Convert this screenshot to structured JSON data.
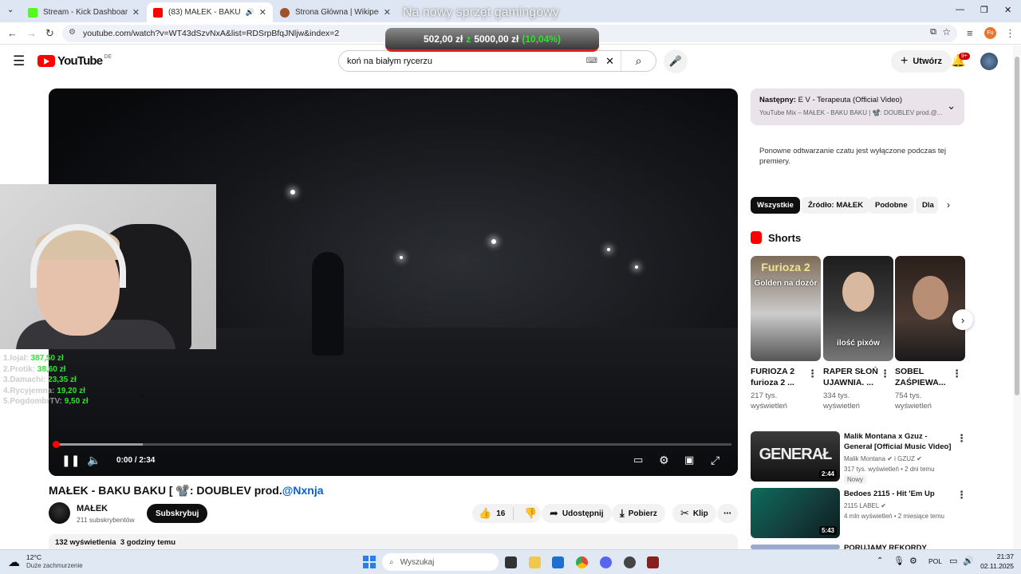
{
  "browser": {
    "tabs": [
      {
        "label": "Stream - Kick Dashboard",
        "color": "#53fc18"
      },
      {
        "label": "(83) MAŁEK - BAKU BAKU | ...",
        "color": "#ff0000"
      },
      {
        "label": "Strona Główna | Wikipedia Gle...",
        "color": "#a0522d"
      }
    ],
    "url": "youtube.com/watch?v=WT43dSzvNxA&list=RDSrpBfqJNljw&index=2"
  },
  "overlay": {
    "title": "Na nowy sprzęt gamingowy",
    "current": "502,00 zł",
    "separator": "z",
    "goal": "5000,00 zł",
    "percent": "(10,04%)",
    "progress_fraction": 0.1004
  },
  "youtube": {
    "logo": "YouTube",
    "country": "DE",
    "search_query": "koń na białym rycerzu",
    "create_label": "Utwórz",
    "notif_badge": "9+"
  },
  "player": {
    "time": "0:00 / 2:34",
    "buffered_fraction": 0.13,
    "played_fraction": 0.0
  },
  "donors": [
    {
      "rank": "1.lojal:",
      "amount": "387,50 zł"
    },
    {
      "rank": "2.Protik:",
      "amount": "38,60 zł"
    },
    {
      "rank": "3.Damachi:",
      "amount": "23,35 zł"
    },
    {
      "rank": "4.Rycyjemna:",
      "amount": "19,20 zł"
    },
    {
      "rank": "5.PogdombrTV:",
      "amount": "9,50 zł"
    }
  ],
  "video": {
    "title_main": "MAŁEK - BAKU BAKU [ 📽️: DOUBLEV prod.",
    "title_handle": "@Nxnja",
    "channel": "MAŁEK",
    "subs": "211 subskrybentów",
    "subscribe": "Subskrybuj",
    "likes": "16",
    "share": "Udostępnij",
    "download": "Pobierz",
    "clip": "Klip",
    "views": "132 wyświetlenia",
    "ago": "3 godziny temu"
  },
  "sidebar": {
    "next_label": "Następny:",
    "next_title": "E V - Terapeuta (Official Video)",
    "next_sub": "YouTube Mix – MAŁEK - BAKU BAKU | 📽️: DOUBLEV prod.@...",
    "chat_off": "Ponowne odtwarzanie czatu jest wyłączone podczas tej premiery.",
    "chips": [
      "Wszystkie",
      "Źródło: MAŁEK",
      "Podobne",
      "Dla"
    ],
    "shorts_label": "Shorts",
    "shorts": [
      {
        "overlay_top": "Furioza 2",
        "overlay_sub": "Golden na dozór",
        "title1": "FURIOZA 2",
        "title2": "furioza 2 ...",
        "views1": "217 tys.",
        "views2": "wyświetleń"
      },
      {
        "overlay_top": "",
        "overlay_sub": "ilość pixów",
        "title1": "RAPER SŁOŃ",
        "title2": "UJAWNIA. ...",
        "views1": "334 tys.",
        "views2": "wyświetleń"
      },
      {
        "overlay_top": "",
        "overlay_sub": "",
        "title1": "SOBEL",
        "title2": "ZAŚPIEWA...",
        "views1": "754 tys.",
        "views2": "wyświetleń"
      }
    ],
    "recs": [
      {
        "thumb_text": "GENERAŁ",
        "duration": "2:44",
        "title": "Malik Montana x Gzuz - Generał [Official Music Video]",
        "channel": "Malik Montana ✔ i GZUZ ✔",
        "meta": "317 tys. wyświetleń • 2 dni temu",
        "badge": "Nowy"
      },
      {
        "thumb_text": "",
        "duration": "5:43",
        "title": "Bedoes 2115 - Hit 'Em Up",
        "channel": "2115 LABEL ✔",
        "meta": "4 mln wyświetleń • 2 miesiące temu",
        "badge": ""
      },
      {
        "thumb_text": "",
        "duration": "",
        "title": "PORUJAMY REKORDY",
        "channel": "",
        "meta": "",
        "badge": ""
      }
    ]
  },
  "taskbar": {
    "weather_temp": "12°C",
    "weather_desc": "Duże zachmurzenie",
    "search_placeholder": "Wyszukaj",
    "lang": "POL",
    "time": "21:37",
    "date": "02.11.2025"
  }
}
